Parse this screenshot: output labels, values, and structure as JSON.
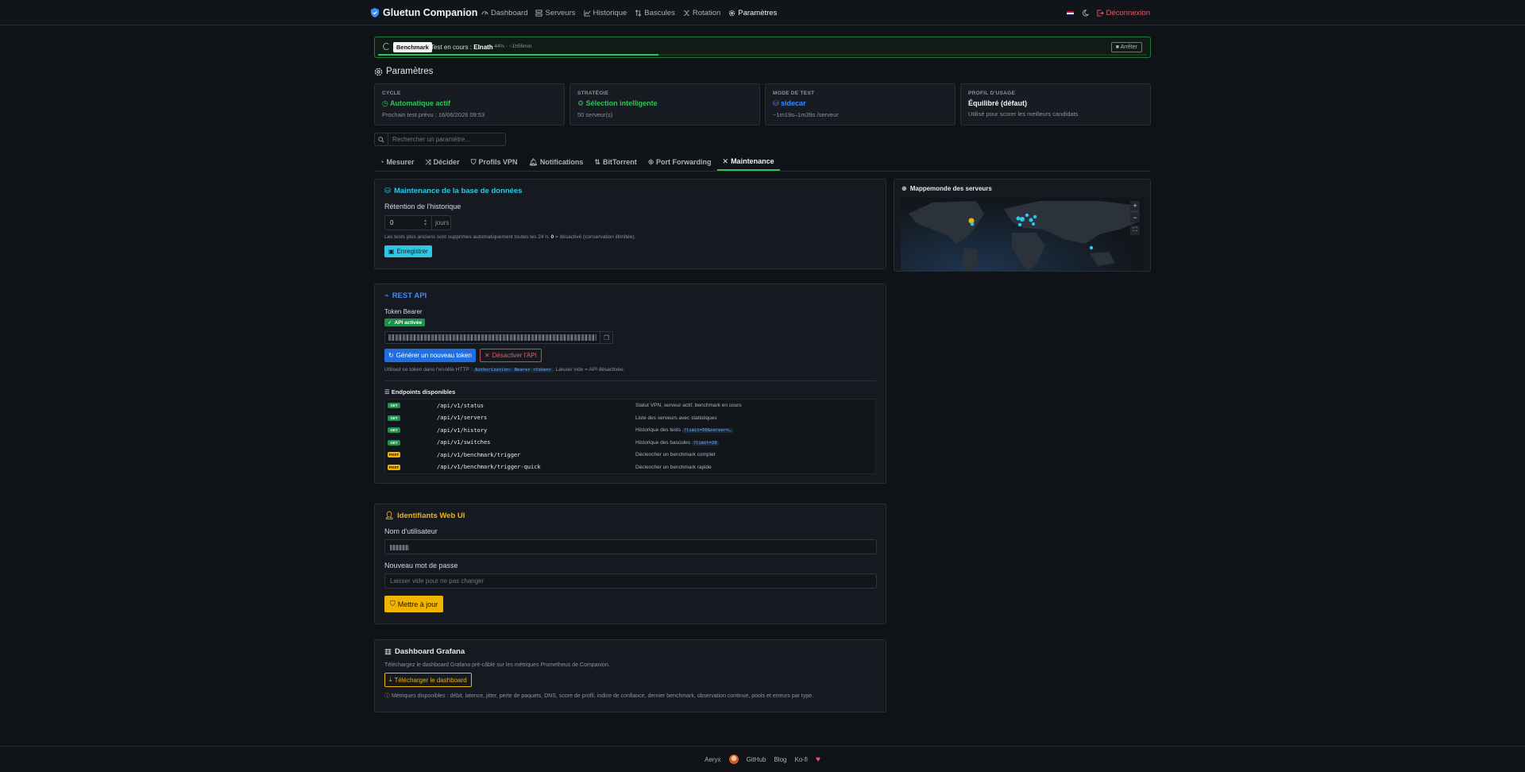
{
  "header": {
    "app_title": "Gluetun Companion",
    "nav": [
      {
        "label": "Dashboard",
        "icon": "speedometer-icon"
      },
      {
        "label": "Serveurs",
        "icon": "server-icon"
      },
      {
        "label": "Historique",
        "icon": "chart-line-icon"
      },
      {
        "label": "Bascules",
        "icon": "switch-icon"
      },
      {
        "label": "Rotation",
        "icon": "shuffle-icon"
      },
      {
        "label": "Paramètres",
        "icon": "gear-icon"
      }
    ],
    "logout": "Déconnexion"
  },
  "benchmark": {
    "tag": "Benchmark",
    "status_prefix": "Test en cours : ",
    "status_server": "Elnath",
    "percent_text": "44% · ~1h56min",
    "progress": 0.365,
    "stop": "Arrêter"
  },
  "page_title": "Paramètres",
  "cards": [
    {
      "label": "CYCLE",
      "value": "Automatique actif",
      "sub": "Prochain test prévu : 16/06/2026 09:53",
      "color": "#2ec45a"
    },
    {
      "label": "STRATÉGIE",
      "value": "Sélection intelligente",
      "sub": "50 serveur(s)",
      "color": "#2ec45a"
    },
    {
      "label": "MODE DE TEST",
      "value": "sidecar",
      "sub": "~1m19s–1m39s /serveur",
      "color": "#3b8cff"
    },
    {
      "label": "PROFIL D'USAGE",
      "value": "Équilibré (défaut)",
      "sub": "Utilisé pour scorer les meilleurs candidats",
      "color": "#f1f3f5"
    }
  ],
  "search": {
    "placeholder": "Rechercher un paramètre..."
  },
  "tabs": [
    {
      "label": "Mesurer",
      "icon": "gauge-icon"
    },
    {
      "label": "Décider",
      "icon": "shuffle-icon"
    },
    {
      "label": "Profils VPN",
      "icon": "shield-icon"
    },
    {
      "label": "Notifications",
      "icon": "bell-icon"
    },
    {
      "label": "BitTorrent",
      "icon": "torrent-icon"
    },
    {
      "label": "Port Forwarding",
      "icon": "network-icon"
    },
    {
      "label": "Maintenance",
      "icon": "tools-icon"
    }
  ],
  "maintenance": {
    "title": "Maintenance de la base de données",
    "retention_label": "Rétention de l'historique",
    "retention_value": "0",
    "retention_unit": "jours",
    "help_before": "Les tests plus anciens sont supprimés automatiquement toutes les 24 h. ",
    "help_bold": "0",
    "help_after": " = désactivé (conservation illimitée).",
    "save": "Enregistrer"
  },
  "map": {
    "title": "Mappemonde des serveurs"
  },
  "api": {
    "title": "REST API",
    "token_label": "Token Bearer",
    "active_badge": "API activée",
    "generate": "Générer un nouveau token",
    "disable": "Désactiver l'API",
    "usage_before": "Utilisez ce token dans l'en-tête HTTP : ",
    "usage_code": "Authorization: Bearer <token>",
    "usage_after": ". Laisser vide = API désactivée.",
    "endpoints_title": "Endpoints disponibles",
    "endpoints": [
      {
        "method": "GET",
        "path": "/api/v1/status",
        "desc": "Statut VPN, serveur actif, benchmark en cours",
        "code": ""
      },
      {
        "method": "GET",
        "path": "/api/v1/servers",
        "desc": "Liste des serveurs avec statistiques",
        "code": ""
      },
      {
        "method": "GET",
        "path": "/api/v1/history",
        "desc": "Historique des tests ",
        "code": "?limit=50&server=…"
      },
      {
        "method": "GET",
        "path": "/api/v1/switches",
        "desc": "Historique des bascules ",
        "code": "?limit=20"
      },
      {
        "method": "POST",
        "path": "/api/v1/benchmark/trigger",
        "desc": "Déclencher un benchmark complet",
        "code": ""
      },
      {
        "method": "POST",
        "path": "/api/v1/benchmark/trigger-quick",
        "desc": "Déclencher un benchmark rapide",
        "code": ""
      }
    ]
  },
  "webui": {
    "title": "Identifiants Web UI",
    "username_label": "Nom d'utilisateur",
    "password_label": "Nouveau mot de passe",
    "password_placeholder": "Laisser vide pour ne pas changer",
    "update": "Mettre à jour"
  },
  "grafana": {
    "title": "Dashboard Grafana",
    "desc": "Téléchargez le dashboard Grafana pré-câblé sur les métriques Prometheus de Companion.",
    "download": "Télécharger le dashboard",
    "metrics": "Métriques disponibles : débit, latence, jitter, perte de paquets, DNS, score de profil, indice de confiance, dernier benchmark, observation continue, pools et erreurs par type."
  },
  "footer": {
    "author": "Aeryx",
    "github": "GitHub",
    "blog": "Blog",
    "kofi": "Ko-fi"
  }
}
